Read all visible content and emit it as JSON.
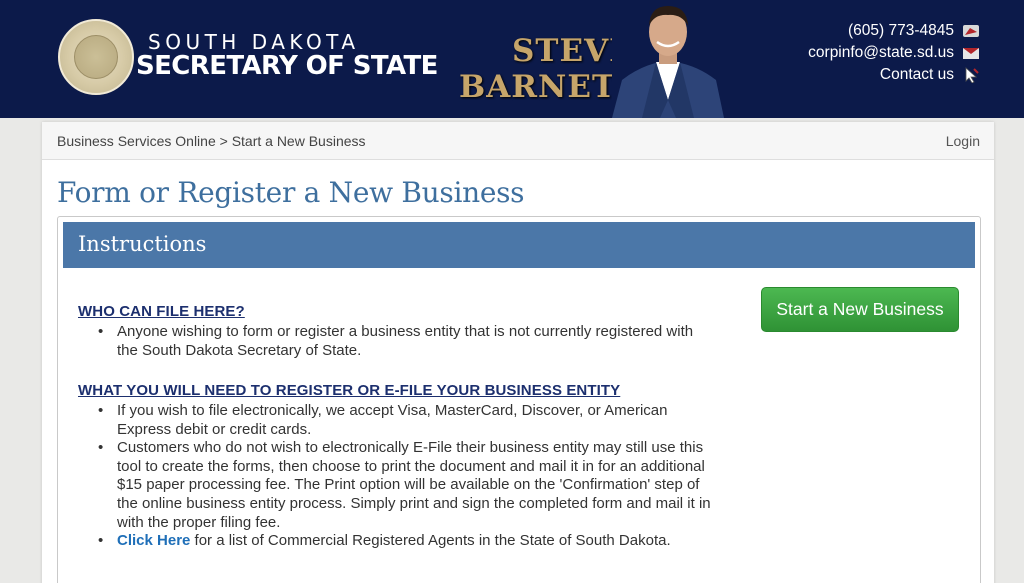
{
  "header": {
    "org_line1": "SOUTH DAKOTA",
    "org_line2": "SECRETARY OF STATE",
    "official_first": "STEVE",
    "official_last": "BARNETT",
    "phone": "(605) 773-4845",
    "email": "corpinfo@state.sd.us",
    "contact": "Contact us",
    "icons": [
      "phone-icon",
      "email-icon",
      "contact-pointer-icon"
    ],
    "colors": {
      "background": "#0c1a4a",
      "name_gold": "#c6a56a"
    }
  },
  "breadcrumb": {
    "text": "Business Services Online > Start a New Business",
    "login": "Login"
  },
  "page_title": "Form or Register a New Business",
  "panel": {
    "title": "Instructions",
    "start_button": "Start a New Business",
    "section1": {
      "heading": "WHO CAN FILE HERE?",
      "items": [
        "Anyone wishing to form or register a business entity that is not currently registered with the South Dakota Secretary of State."
      ]
    },
    "section2": {
      "heading": "WHAT YOU WILL NEED TO REGISTER OR E-FILE YOUR BUSINESS ENTITY",
      "items": [
        "If you wish to file electronically, we accept Visa, MasterCard, Discover, or American Express debit or credit cards.",
        "Customers who do not wish to electronically E-File their business entity may still use this tool to create the forms, then choose to print the document and mail it in for an additional $15 paper processing fee. The Print option will be available on the 'Confirmation' step of the online business entity process. Simply print and sign the completed form and mail it in with the proper filing fee."
      ],
      "link_text": "Click Here",
      "link_suffix": " for a list of Commercial Registered Agents in the State of South Dakota."
    },
    "colors": {
      "header": "#4b77a8",
      "button": "#3aa140",
      "heading": "#1c2f6e",
      "link": "#1f6fb8"
    }
  }
}
